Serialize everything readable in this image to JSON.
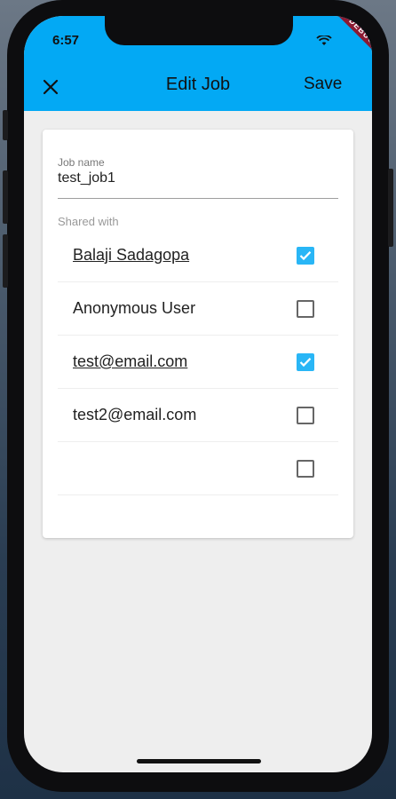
{
  "status_bar": {
    "time": "6:57",
    "debug_banner": "DEBUG"
  },
  "app_bar": {
    "title": "Edit Job",
    "close_icon": "close-icon",
    "save_label": "Save",
    "color": "#03a9f4"
  },
  "form": {
    "job_name_label": "Job name",
    "job_name_value": "test_job1",
    "shared_with_label": "Shared with",
    "shared_users": [
      {
        "name": "Balaji Sadagopa",
        "checked": true
      },
      {
        "name": "Anonymous User",
        "checked": false
      },
      {
        "name": "test@email.com",
        "checked": true
      },
      {
        "name": "test2@email.com",
        "checked": false
      },
      {
        "name": "",
        "checked": false
      }
    ],
    "checkbox_color": "#29b6f6"
  }
}
